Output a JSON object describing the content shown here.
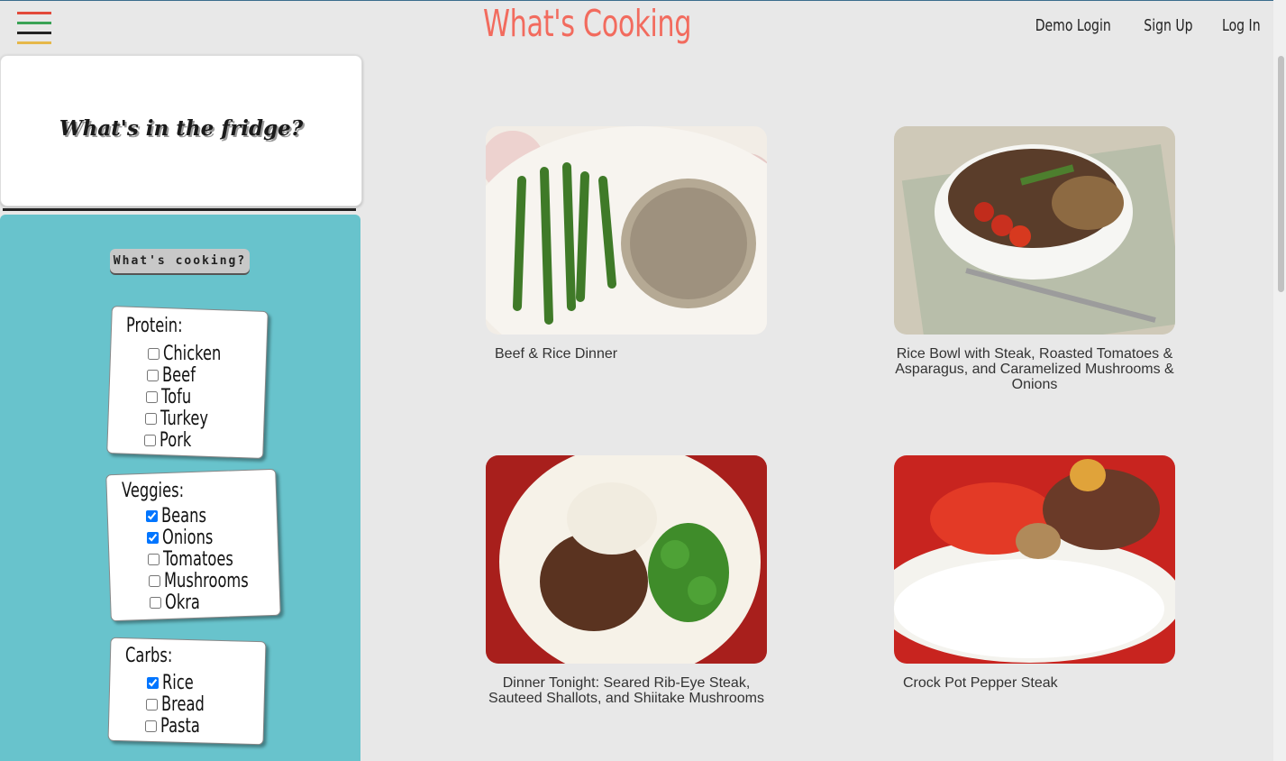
{
  "header": {
    "app_title": "What's Cooking",
    "nav": [
      "Demo Login",
      "Sign Up",
      "Log In"
    ],
    "menu_colors": [
      "#e24a3b",
      "#3aa356",
      "#222222",
      "#e6b84a"
    ]
  },
  "sidebar": {
    "fridge_title": "What's in the fridge?",
    "submit_label": "What's cooking?",
    "categories": [
      {
        "title": "Protein:",
        "items": [
          {
            "label": "Chicken",
            "checked": false
          },
          {
            "label": "Beef",
            "checked": false
          },
          {
            "label": "Tofu",
            "checked": false
          },
          {
            "label": "Turkey",
            "checked": false
          },
          {
            "label": "Pork",
            "checked": false
          }
        ]
      },
      {
        "title": "Veggies:",
        "items": [
          {
            "label": "Beans",
            "checked": true
          },
          {
            "label": "Onions",
            "checked": true
          },
          {
            "label": "Tomatoes",
            "checked": false
          },
          {
            "label": "Mushrooms",
            "checked": false
          },
          {
            "label": "Okra",
            "checked": false
          }
        ]
      },
      {
        "title": "Carbs:",
        "items": [
          {
            "label": "Rice",
            "checked": true
          },
          {
            "label": "Bread",
            "checked": false
          },
          {
            "label": "Pasta",
            "checked": false
          }
        ]
      }
    ]
  },
  "recipes": [
    {
      "name": "Beef & Rice Dinner",
      "align": "left"
    },
    {
      "name": "Rice Bowl with Steak, Roasted Tomatoes & Asparagus, and Caramelized Mushrooms & Onions",
      "align": "center"
    },
    {
      "name": "Dinner Tonight: Seared Rib-Eye Steak, Sauteed Shallots, and Shiitake Mushrooms",
      "align": "center"
    },
    {
      "name": "Crock Pot Pepper Steak",
      "align": "left"
    }
  ],
  "colors": {
    "accent": "#f26b5e",
    "panel": "#68c3cc",
    "background": "#e8e8e8"
  }
}
